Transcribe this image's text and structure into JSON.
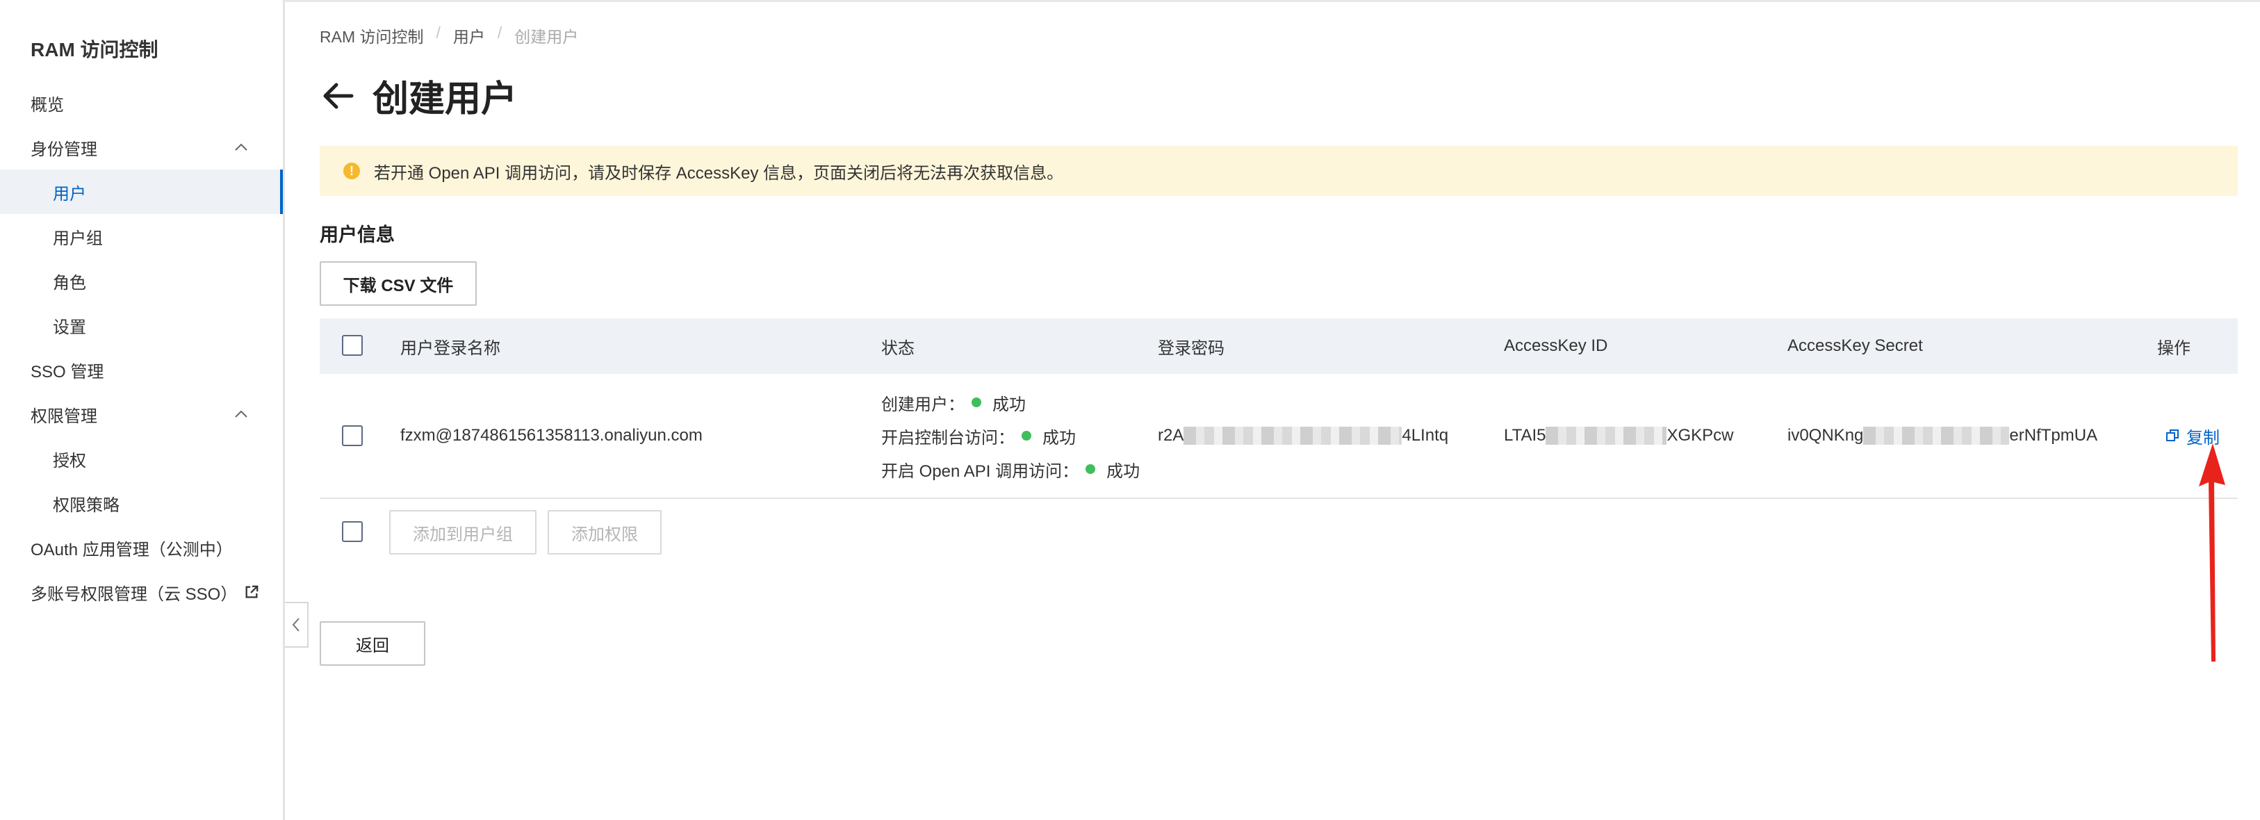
{
  "sidebar": {
    "title": "RAM 访问控制",
    "items": [
      {
        "label": "概览"
      },
      {
        "label": "身份管理"
      },
      {
        "label": "用户"
      },
      {
        "label": "用户组"
      },
      {
        "label": "角色"
      },
      {
        "label": "设置"
      },
      {
        "label": "SSO 管理"
      },
      {
        "label": "权限管理"
      },
      {
        "label": "授权"
      },
      {
        "label": "权限策略"
      },
      {
        "label": "OAuth 应用管理（公测中）"
      },
      {
        "label": "多账号权限管理（云 SSO）"
      }
    ]
  },
  "breadcrumb": [
    "RAM 访问控制",
    "用户",
    "创建用户"
  ],
  "breadcrumb_sep": "/",
  "page": {
    "title": "创建用户",
    "alert": "若开通 Open API 调用访问，请及时保存 AccessKey 信息，页面关闭后将无法再次获取信息。",
    "section_title": "用户信息",
    "download_button": "下载 CSV 文件",
    "add_to_group_button": "添加到用户组",
    "add_permission_button": "添加权限",
    "back_button": "返回"
  },
  "table": {
    "columns": [
      "用户登录名称",
      "状态",
      "登录密码",
      "AccessKey ID",
      "AccessKey Secret",
      "操作"
    ],
    "row": {
      "login_name": "fzxm@1874861561358113.onaliyun.com",
      "status": [
        {
          "label": "创建用户：",
          "value": "成功"
        },
        {
          "label": "开启控制台访问：",
          "value": "成功"
        },
        {
          "label": "开启 Open API 调用访问：",
          "value": "成功"
        }
      ],
      "password_prefix": "r2A",
      "password_suffix": "4LIntq",
      "accesskey_id_prefix": "LTAI5",
      "accesskey_id_suffix": "XGKPcw",
      "accesskey_secret_prefix": "iv0QNKng",
      "accesskey_secret_suffix": "erNfTpmUA",
      "action": "复制"
    }
  },
  "colors": {
    "accent": "#0064c8",
    "success": "#3fbf5c",
    "warning_bg": "#fef6da",
    "annotation": "#e8231c"
  }
}
